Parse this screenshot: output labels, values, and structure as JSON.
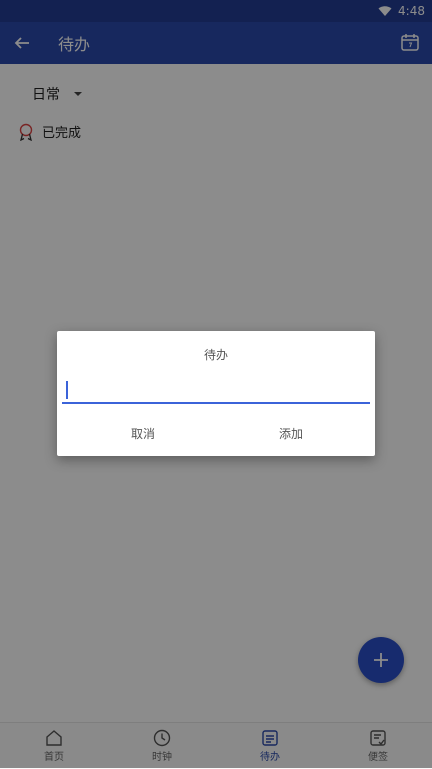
{
  "status": {
    "time": "4:48"
  },
  "appbar": {
    "title": "待办"
  },
  "main": {
    "category": "日常",
    "completed_label": "已完成"
  },
  "nav": {
    "items": [
      {
        "label": "首页"
      },
      {
        "label": "时钟"
      },
      {
        "label": "待办"
      },
      {
        "label": "便签"
      }
    ],
    "active": "待办"
  },
  "dialog": {
    "title": "待办",
    "input_value": "",
    "cancel": "取消",
    "add": "添加"
  },
  "colors": {
    "statusbar": "#233d94",
    "appbar": "#2b4aab",
    "accent": "#3b63d9",
    "fab": "#2b4fc9"
  },
  "icons": {
    "back": "arrow-left-icon",
    "calendar": "calendar-icon",
    "completed": "award-icon",
    "fab": "plus-icon",
    "home": "home-icon",
    "clock": "clock-icon",
    "todo": "todo-icon",
    "note": "note-icon"
  }
}
